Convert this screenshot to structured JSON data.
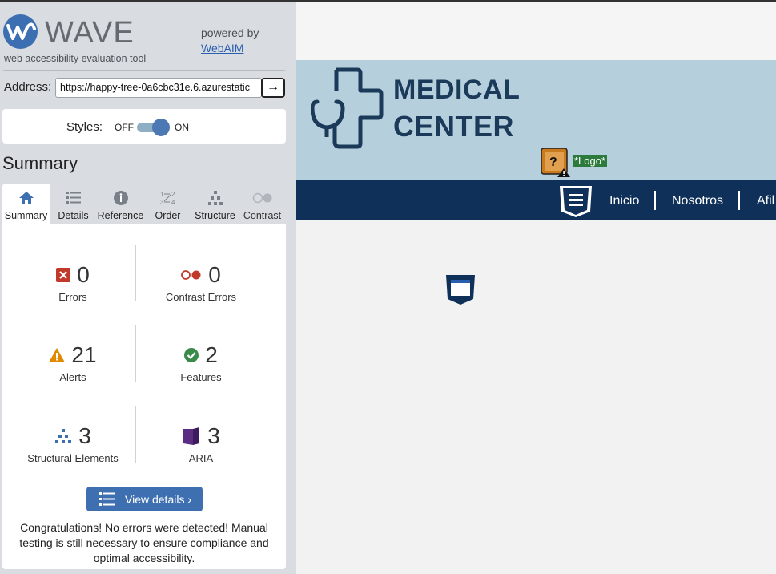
{
  "wave": {
    "title": "WAVE",
    "subtitle": "web accessibility evaluation tool",
    "powered_by": "powered by",
    "webaim_link": "WebAIM",
    "address_label": "Address:",
    "address_value": "https://happy-tree-0a6cbc31e.6.azurestatic",
    "go_symbol": "→",
    "styles_label": "Styles:",
    "styles_off": "OFF",
    "styles_on": "ON",
    "styles_enabled": true,
    "summary_heading": "Summary",
    "tabs": [
      {
        "label": "Summary",
        "icon": "home-icon",
        "active": true
      },
      {
        "label": "Details",
        "icon": "list-icon",
        "active": false
      },
      {
        "label": "Reference",
        "icon": "info-icon",
        "active": false
      },
      {
        "label": "Order",
        "icon": "order-icon",
        "active": false
      },
      {
        "label": "Structure",
        "icon": "structure-icon",
        "active": false
      },
      {
        "label": "Contrast",
        "icon": "contrast-icon",
        "active": false
      }
    ],
    "stats": {
      "errors": {
        "value": "0",
        "label": "Errors"
      },
      "contrast_errors": {
        "value": "0",
        "label": "Contrast Errors"
      },
      "alerts": {
        "value": "21",
        "label": "Alerts"
      },
      "features": {
        "value": "2",
        "label": "Features"
      },
      "structural": {
        "value": "3",
        "label": "Structural Elements"
      },
      "aria": {
        "value": "3",
        "label": "ARIA"
      }
    },
    "view_details": "View details ›",
    "congrats": "Congratulations! No errors were detected! Manual testing is still necessary to ensure compliance and optimal accessibility."
  },
  "site": {
    "brand_line1": "MEDICAL",
    "brand_line2": "CENTER",
    "logo_alt_tag": "*Logo*",
    "nav": [
      "Inicio",
      "Nosotros",
      "Afil"
    ]
  },
  "colors": {
    "wave_blue": "#3e6fb0",
    "error_red": "#c0392b",
    "alert_orange": "#e08a00",
    "feature_green": "#3a8a4a",
    "aria_purple": "#5a2d82",
    "site_navy": "#0f3058",
    "header_blue": "#b5cfdc"
  }
}
